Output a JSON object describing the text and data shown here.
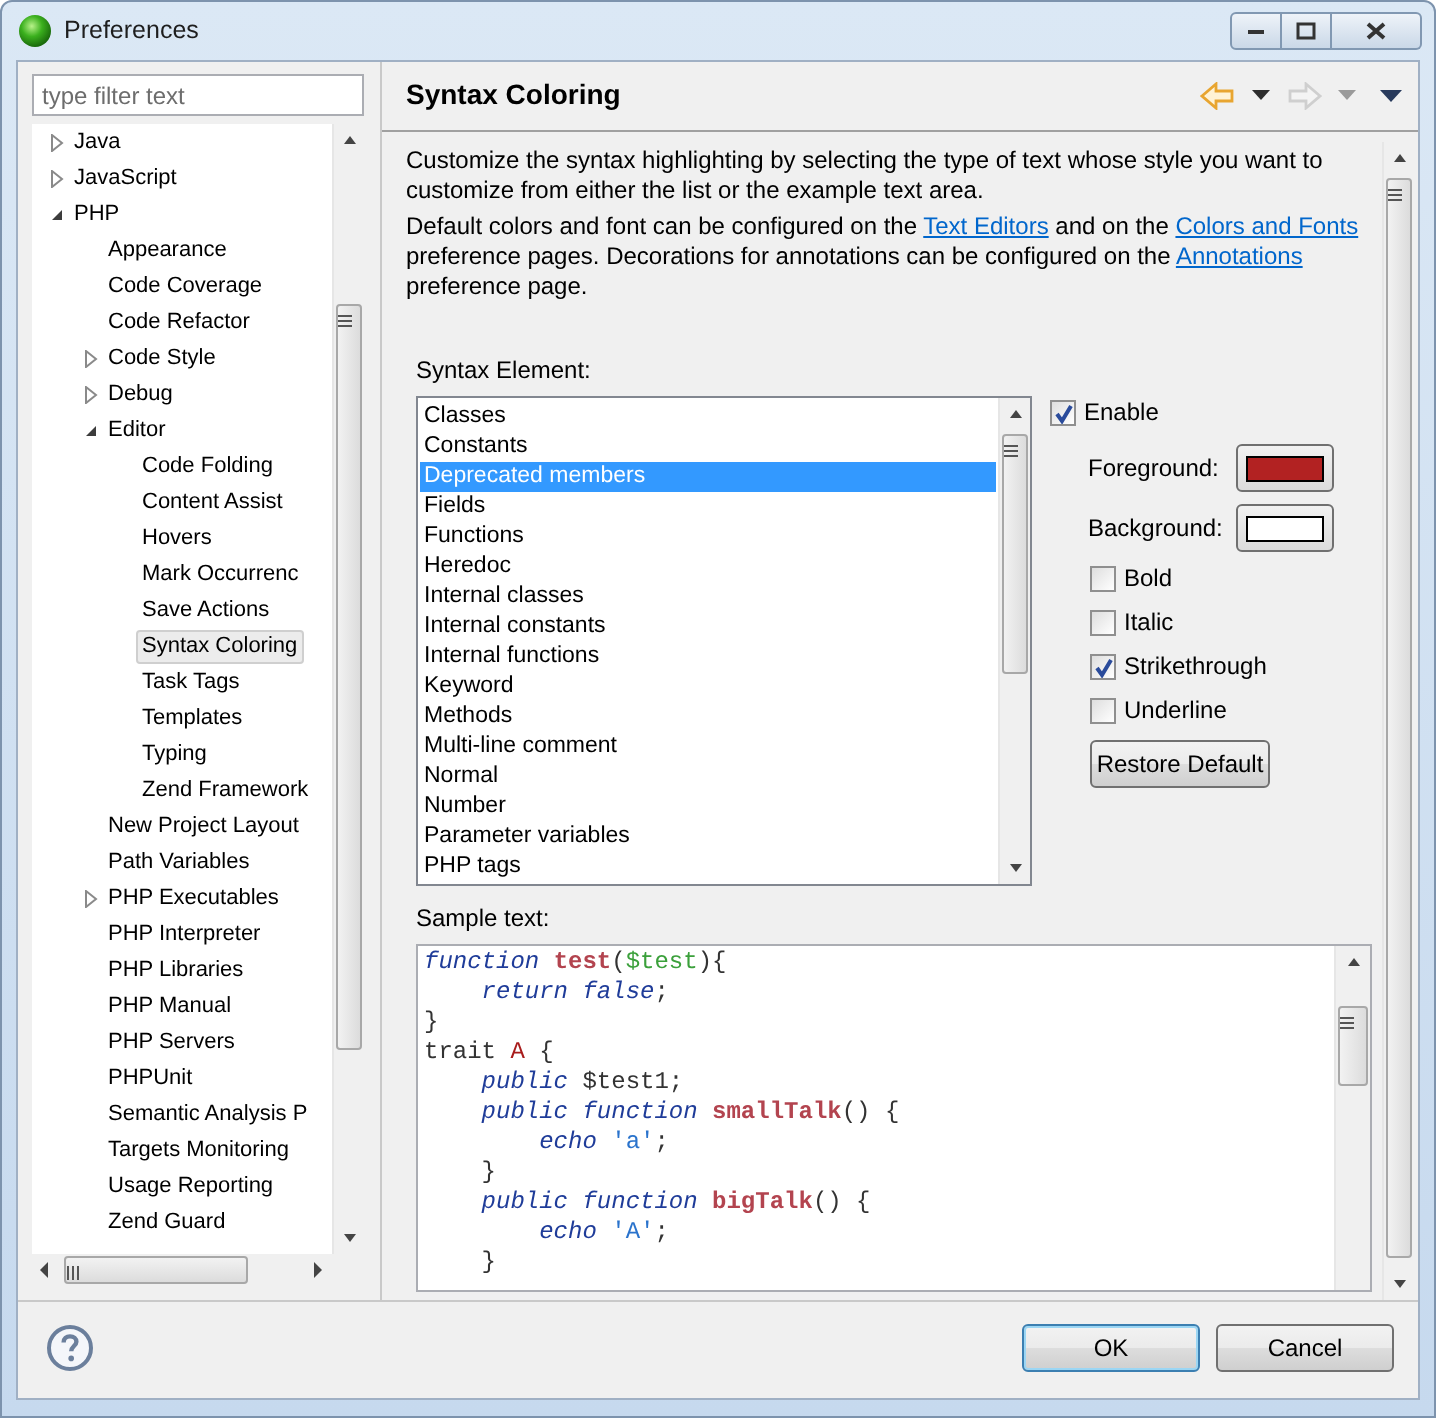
{
  "window": {
    "title": "Preferences"
  },
  "filter": {
    "placeholder": "type filter text"
  },
  "tree": [
    {
      "label": "Java",
      "expanded": false,
      "selected": false
    },
    {
      "label": "JavaScript",
      "expanded": false,
      "selected": false
    },
    {
      "label": "PHP",
      "expanded": true,
      "selected": false,
      "children": [
        {
          "label": "Appearance",
          "selected": false
        },
        {
          "label": "Code Coverage",
          "selected": false
        },
        {
          "label": "Code Refactor",
          "selected": false
        },
        {
          "label": "Code Style",
          "expanded": false,
          "selected": false
        },
        {
          "label": "Debug",
          "expanded": false,
          "selected": false
        },
        {
          "label": "Editor",
          "expanded": true,
          "selected": false,
          "children": [
            {
              "label": "Code Folding",
              "selected": false
            },
            {
              "label": "Content Assist",
              "selected": false
            },
            {
              "label": "Hovers",
              "selected": false
            },
            {
              "label": "Mark Occurrenc",
              "selected": false
            },
            {
              "label": "Save Actions",
              "selected": false
            },
            {
              "label": "Syntax Coloring",
              "selected": true
            },
            {
              "label": "Task Tags",
              "selected": false
            },
            {
              "label": "Templates",
              "selected": false
            },
            {
              "label": "Typing",
              "selected": false
            },
            {
              "label": "Zend Framework",
              "selected": false
            }
          ]
        },
        {
          "label": "New Project Layout",
          "selected": false
        },
        {
          "label": "Path Variables",
          "selected": false
        },
        {
          "label": "PHP Executables",
          "expanded": false,
          "selected": false
        },
        {
          "label": "PHP Interpreter",
          "selected": false
        },
        {
          "label": "PHP Libraries",
          "selected": false
        },
        {
          "label": "PHP Manual",
          "selected": false
        },
        {
          "label": "PHP Servers",
          "selected": false
        },
        {
          "label": "PHPUnit",
          "selected": false
        },
        {
          "label": "Semantic Analysis P",
          "selected": false
        },
        {
          "label": "Targets Monitoring",
          "selected": false
        },
        {
          "label": "Usage Reporting",
          "selected": false
        },
        {
          "label": "Zend Guard",
          "selected": false
        }
      ]
    }
  ],
  "page": {
    "title": "Syntax Coloring",
    "nav": [
      {
        "kind": "back",
        "disabled": false
      },
      {
        "kind": "dropdown",
        "disabled": false
      },
      {
        "kind": "forward",
        "disabled": true
      },
      {
        "kind": "dropdown",
        "disabled": true
      },
      {
        "kind": "menu",
        "disabled": false
      }
    ],
    "description": [
      [
        {
          "kind": "text",
          "text": "Customize the syntax highlighting by selecting the type of text whose style you want to customize from either the list or the example text area."
        }
      ],
      [
        {
          "kind": "text",
          "text": "Default colors and font can be configured on the "
        },
        {
          "kind": "link",
          "text": "Text Editors"
        },
        {
          "kind": "text",
          "text": " and on the "
        },
        {
          "kind": "link",
          "text": "Colors and Fonts"
        },
        {
          "kind": "text",
          "text": " preference pages.  Decorations for annotations can be configured on the "
        },
        {
          "kind": "link",
          "text": "Annotations"
        },
        {
          "kind": "text",
          "text": " preference page."
        }
      ]
    ],
    "syntax_element": {
      "label": "Syntax Element:",
      "items": [
        {
          "label": "Classes",
          "selected": false
        },
        {
          "label": "Constants",
          "selected": false
        },
        {
          "label": "Deprecated members",
          "selected": true
        },
        {
          "label": "Fields",
          "selected": false
        },
        {
          "label": "Functions",
          "selected": false
        },
        {
          "label": "Heredoc",
          "selected": false
        },
        {
          "label": "Internal classes",
          "selected": false
        },
        {
          "label": "Internal constants",
          "selected": false
        },
        {
          "label": "Internal functions",
          "selected": false
        },
        {
          "label": "Keyword",
          "selected": false
        },
        {
          "label": "Methods",
          "selected": false
        },
        {
          "label": "Multi-line comment",
          "selected": false
        },
        {
          "label": "Normal",
          "selected": false
        },
        {
          "label": "Number",
          "selected": false
        },
        {
          "label": "Parameter variables",
          "selected": false
        },
        {
          "label": "PHP tags",
          "selected": false
        }
      ]
    },
    "enable": {
      "label": "Enable",
      "checked": true
    },
    "colors": [
      {
        "label": "Foreground:",
        "color": "#b22222"
      },
      {
        "label": "Background:",
        "color": "#ffffff"
      }
    ],
    "styles": [
      {
        "label": "Bold",
        "checked": false
      },
      {
        "label": "Italic",
        "checked": false
      },
      {
        "label": "Strikethrough",
        "checked": true
      },
      {
        "label": "Underline",
        "checked": false
      }
    ],
    "restore_button": "Restore Default",
    "sample": {
      "label": "Sample text:",
      "lines": [
        [
          {
            "kind": "keyword",
            "text": "function "
          },
          {
            "kind": "function",
            "text": "test"
          },
          {
            "kind": "plain",
            "text": "("
          },
          {
            "kind": "variable",
            "text": "$test"
          },
          {
            "kind": "plain",
            "text": "){"
          }
        ],
        [
          {
            "kind": "keyword",
            "text": "    return false"
          },
          {
            "kind": "plain",
            "text": ";"
          }
        ],
        [
          {
            "kind": "plain",
            "text": "}"
          }
        ],
        [
          {
            "kind": "plain",
            "text": "trait "
          },
          {
            "kind": "class",
            "text": "A"
          },
          {
            "kind": "plain",
            "text": " {"
          }
        ],
        [
          {
            "kind": "keyword",
            "text": "    public"
          },
          {
            "kind": "plain",
            "text": " $test1;"
          }
        ],
        [
          {
            "kind": "keyword",
            "text": "    public function "
          },
          {
            "kind": "function",
            "text": "smallTalk"
          },
          {
            "kind": "plain",
            "text": "() {"
          }
        ],
        [
          {
            "kind": "keyword",
            "text": "        echo "
          },
          {
            "kind": "string",
            "text": "'a'"
          },
          {
            "kind": "plain",
            "text": ";"
          }
        ],
        [
          {
            "kind": "plain",
            "text": "    }"
          }
        ],
        [
          {
            "kind": "keyword",
            "text": "    public function "
          },
          {
            "kind": "function",
            "text": "bigTalk"
          },
          {
            "kind": "plain",
            "text": "() {"
          }
        ],
        [
          {
            "kind": "keyword",
            "text": "        echo "
          },
          {
            "kind": "string",
            "text": "'A'"
          },
          {
            "kind": "plain",
            "text": ";"
          }
        ],
        [
          {
            "kind": "plain",
            "text": "    }"
          }
        ]
      ]
    }
  },
  "buttons": [
    {
      "label": "OK",
      "default": true
    },
    {
      "label": "Cancel",
      "default": false
    }
  ]
}
